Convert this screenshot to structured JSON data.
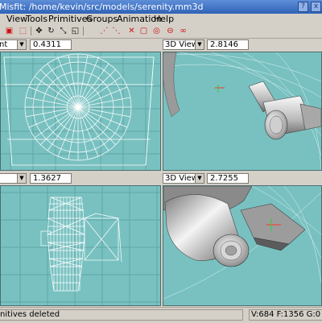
{
  "window": {
    "title": "Misfit: /home/kevin/src/models/serenity.mm3d",
    "buttons": [
      "?",
      "x"
    ]
  },
  "menu": {
    "items": [
      {
        "label": "View",
        "mnemonic": "V"
      },
      {
        "label": "Tools",
        "mnemonic": "T"
      },
      {
        "label": "Primitives",
        "mnemonic": "P"
      },
      {
        "label": "Groups",
        "mnemonic": "G"
      },
      {
        "label": "Animation",
        "mnemonic": "A"
      },
      {
        "label": "Help",
        "mnemonic": "H"
      }
    ]
  },
  "toolbar": {
    "icons": [
      "select-icon",
      "select-box-icon",
      "move-icon",
      "rotate-icon",
      "scale-icon",
      "vertex-icon",
      "attach-icon",
      "add-face-icon",
      "delete-icon",
      "cube-icon",
      "sphere-icon",
      "cylinder-icon",
      "torus-icon"
    ]
  },
  "viewports": {
    "top_left": {
      "view": "nt",
      "zoom": "0.4311"
    },
    "top_right": {
      "view": "3D View",
      "zoom": "2.8146"
    },
    "bottom_left": {
      "view": "",
      "zoom": "1.3627"
    },
    "bottom_right": {
      "view": "3D View",
      "zoom": "2.7255"
    }
  },
  "status": {
    "message": "nitives deleted",
    "stats": "V:684 F:1356 G:0 B:0"
  },
  "colors": {
    "viewport_bg": "#79c1c1",
    "grid": "#5fa6a6",
    "wireframe": "#ffffff",
    "selection": "#ff3030",
    "titlebar": "#3f73c8"
  }
}
